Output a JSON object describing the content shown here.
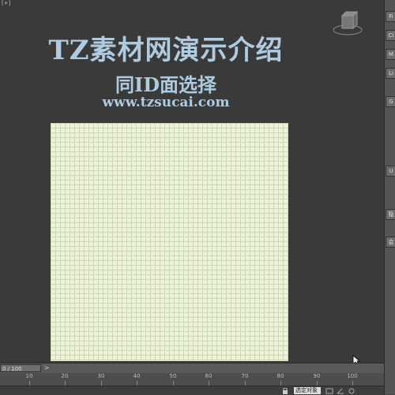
{
  "viewport": {
    "label": "[+]",
    "title_line1": "TZ素材网演示介绍",
    "title_line2": "同ID面选择",
    "title_line3": "www.tzsucai.com"
  },
  "right_panel": {
    "items": [
      "Fi",
      "Ci",
      "M",
      "Li",
      "G",
      "U",
      "隐",
      "会"
    ]
  },
  "timebar": {
    "frame_display": "0 / 100",
    "next_label": ">"
  },
  "ruler": {
    "ticks": [
      "10",
      "20",
      "30",
      "40",
      "50",
      "60",
      "70",
      "80",
      "90",
      "100"
    ]
  },
  "statusbar": {
    "field_text": "选定对象"
  },
  "colors": {
    "viewport_bg": "#3a3a3a",
    "title_color": "#aecbe0",
    "plane_color": "#eef2d6",
    "grid_color": "#cfd6b8"
  }
}
